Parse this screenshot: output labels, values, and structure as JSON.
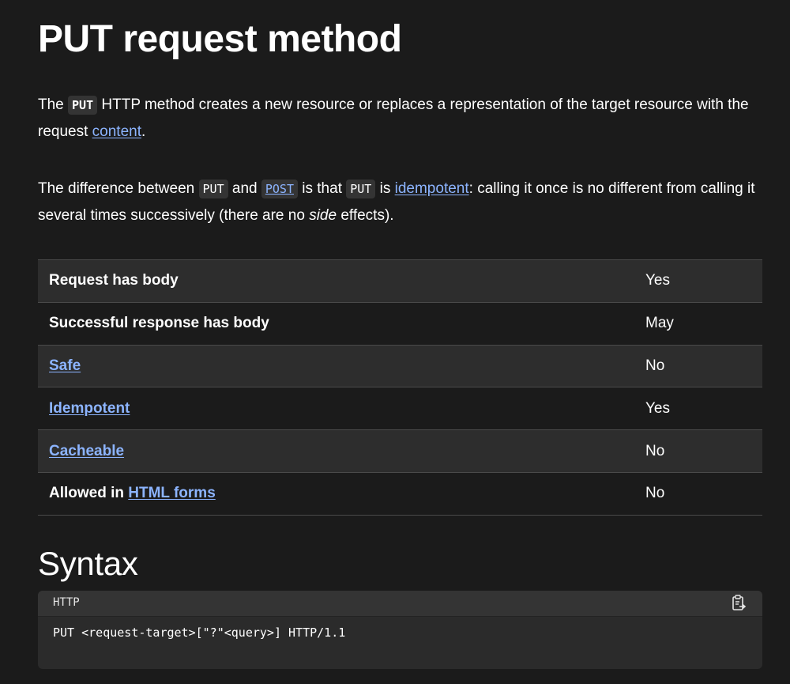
{
  "title": "PUT request method",
  "intro": {
    "p1": {
      "t1": "The ",
      "code_put": "PUT",
      "t2": " HTTP method creates a new resource or replaces a representation of the target resource with the request ",
      "link_content": "content",
      "t3": "."
    },
    "p2": {
      "t1": "The difference between ",
      "code_put": "PUT",
      "t2": " and ",
      "code_post": "POST",
      "t3": " is that ",
      "t4": " is ",
      "link_idempotent": "idempotent",
      "t5": ": calling it once is no different from calling it several times successively (there are no ",
      "em_side": "side",
      "t6": " effects)."
    }
  },
  "properties": [
    {
      "key": "Request has body",
      "value": "Yes"
    },
    {
      "key": "Successful response has body",
      "value": "May"
    },
    {
      "key": "Safe",
      "value": "No"
    },
    {
      "key": "Idempotent",
      "value": "Yes"
    },
    {
      "key": "Cacheable",
      "value": "No"
    },
    {
      "key_prefix": "Allowed in ",
      "key_link": "HTML forms",
      "value": "No"
    }
  ],
  "syntax": {
    "heading": "Syntax",
    "language": "HTTP",
    "code": "PUT <request-target>[\"?\"<query>] HTTP/1.1",
    "copy_icon": "clipboard-copy-icon"
  },
  "colors": {
    "background": "#1b1b1b",
    "link": "#8cb4ff",
    "stripe": "#2d2d2d"
  }
}
